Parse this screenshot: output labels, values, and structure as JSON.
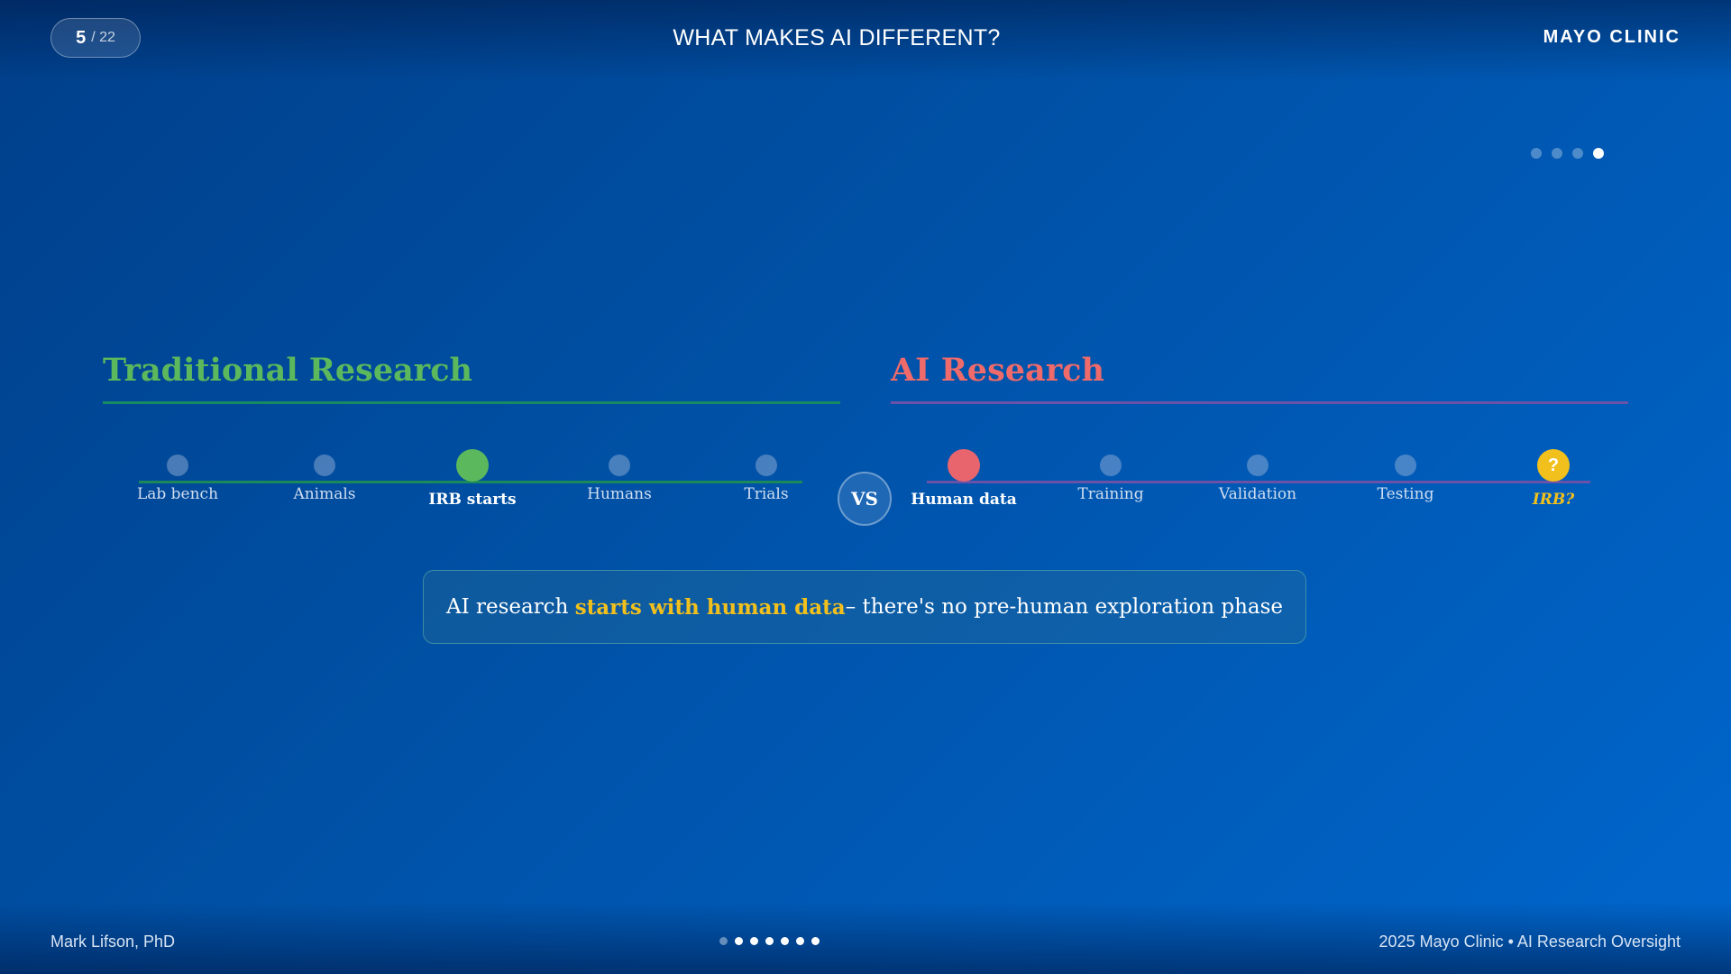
{
  "header": {
    "slide_current": "5",
    "slide_total": "/ 22",
    "title": "WHAT MAKES AI DIFFERENT?",
    "brand": "MAYO CLINIC"
  },
  "build_steps": {
    "total": 4,
    "active_index": 3
  },
  "traditional": {
    "title": "Traditional Research",
    "color": "#5cb85c",
    "steps": [
      {
        "label": "Lab bench"
      },
      {
        "label": "Animals"
      },
      {
        "label": "IRB starts"
      },
      {
        "label": "Humans"
      },
      {
        "label": "Trials"
      }
    ]
  },
  "vs_label": "VS",
  "ai": {
    "title": "AI Research",
    "color": "#ef6a6a",
    "steps": [
      {
        "label": "Human data"
      },
      {
        "label": "Training"
      },
      {
        "label": "Validation"
      },
      {
        "label": "Testing"
      },
      {
        "label": "IRB?",
        "icon": "question-icon",
        "icon_text": "?"
      }
    ]
  },
  "callout": {
    "prefix": "AI research ",
    "highlight": "starts with human data",
    "suffix": " – there's no pre-human exploration phase"
  },
  "footer": {
    "author": "Mark Lifson, PhD",
    "credit": "2025 Mayo Clinic • AI Research Oversight"
  },
  "progress": {
    "total": 7,
    "dim_indices": [
      0
    ]
  },
  "colors": {
    "highlight": "#f2c01c",
    "background": "#0052a8"
  }
}
